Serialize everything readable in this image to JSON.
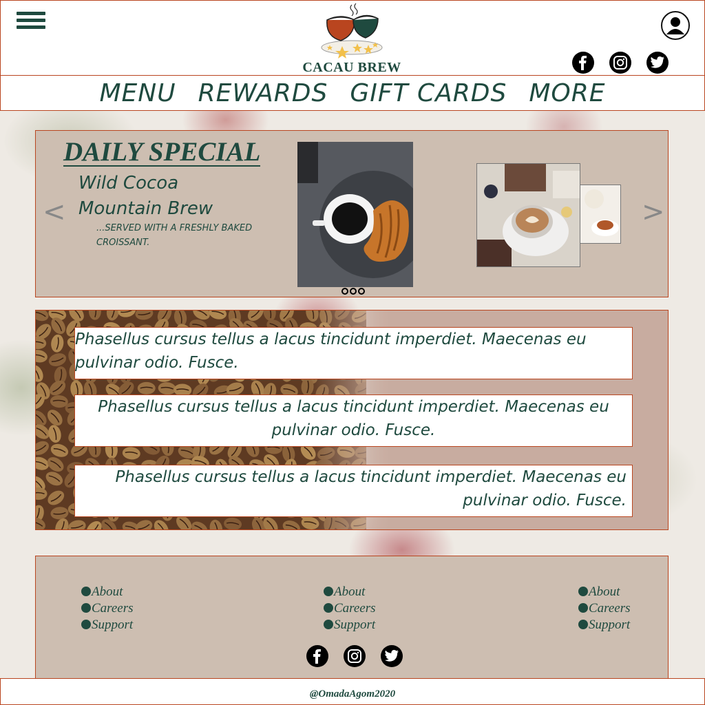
{
  "brand": {
    "name": "CACAU BREW"
  },
  "nav": {
    "items": [
      "MENU",
      "REWARDS",
      "GIFT CARDS",
      "MORE"
    ]
  },
  "special": {
    "title": "DAILY SPECIAL",
    "name_line1": "Wild Cocoa",
    "name_line2": "Mountain Brew",
    "description": "...SERVED WITH A FRESHLY BAKED CROISSANT.",
    "prev_arrow": "<",
    "next_arrow": ">"
  },
  "content": {
    "paragraphs": [
      "Phasellus cursus tellus a lacus tincidunt imperdiet. Maecenas eu pulvinar odio. Fusce.",
      "Phasellus cursus tellus a lacus tincidunt imperdiet. Maecenas eu pulvinar odio. Fusce.",
      "Phasellus cursus tellus a lacus tincidunt imperdiet. Maecenas eu pulvinar odio. Fusce."
    ]
  },
  "footer": {
    "columns": [
      [
        "About",
        "Careers",
        "Support"
      ],
      [
        "About",
        "Careers",
        "Support"
      ],
      [
        "About",
        "Careers",
        "Support"
      ]
    ],
    "copyright": "@OmadaAgom2020"
  },
  "icons": {
    "menu": "hamburger-menu-icon",
    "account": "user-account-icon",
    "social": [
      "facebook-icon",
      "instagram-icon",
      "twitter-icon"
    ]
  },
  "colors": {
    "accent_green": "#1f4a3f",
    "border_rust": "#b9451f",
    "card_beige": "#cdbeb1"
  }
}
